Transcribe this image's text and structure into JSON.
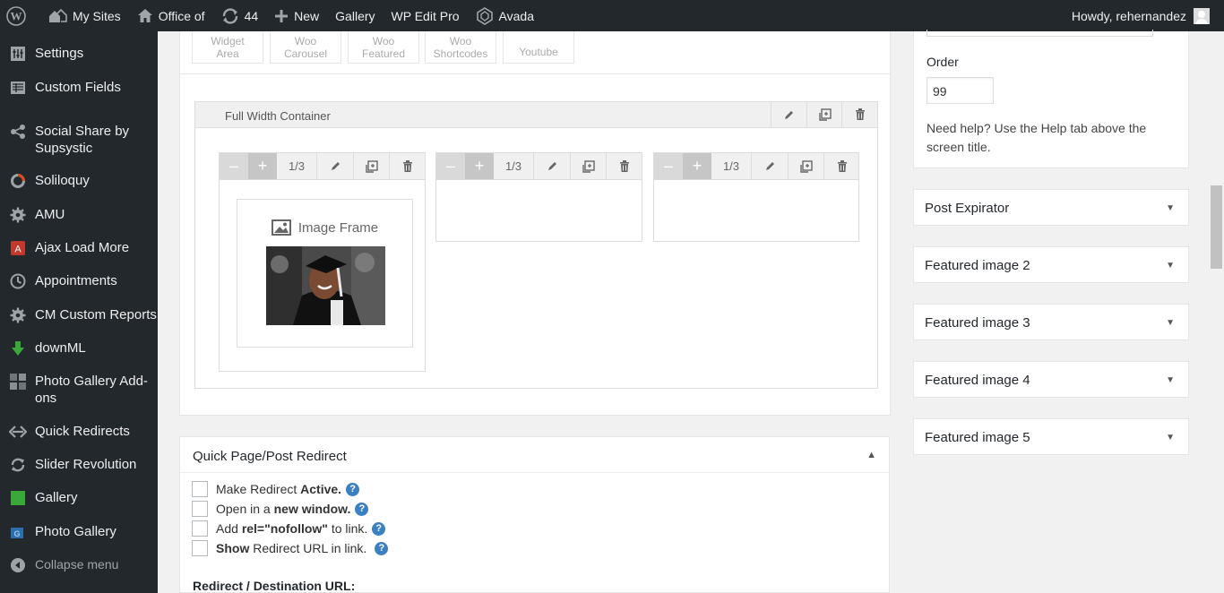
{
  "adminbar": {
    "my_sites": "My Sites",
    "site_name": "Office of",
    "updates_count": "44",
    "new_label": "New",
    "gallery_label": "Gallery",
    "wp_edit_pro_label": "WP Edit Pro",
    "avada_label": "Avada",
    "howdy": "Howdy, rehernandez"
  },
  "sidebar": {
    "items": [
      {
        "label": "Settings",
        "icon": "settings-icon"
      },
      {
        "label": "Custom Fields",
        "icon": "custom-fields-icon"
      },
      {
        "label": "Social Share by Supsystic",
        "icon": "share-icon"
      },
      {
        "label": "Soliloquy",
        "icon": "soliloquy-icon"
      },
      {
        "label": "AMU",
        "icon": "gear-icon"
      },
      {
        "label": "Ajax Load More",
        "icon": "ajax-load-more-icon"
      },
      {
        "label": "Appointments",
        "icon": "clock-icon"
      },
      {
        "label": "CM Custom Reports",
        "icon": "gear-icon"
      },
      {
        "label": "downML",
        "icon": "download-arrow-icon"
      },
      {
        "label": "Photo Gallery Add-ons",
        "icon": "photo-gallery-addons-icon"
      },
      {
        "label": "Quick Redirects",
        "icon": "redirect-icon"
      },
      {
        "label": "Slider Revolution",
        "icon": "refresh-icon"
      },
      {
        "label": "Gallery",
        "icon": "gallery-icon"
      },
      {
        "label": "Photo Gallery",
        "icon": "photo-gallery-icon"
      }
    ],
    "collapse_label": "Collapse menu"
  },
  "builder": {
    "elements": [
      {
        "label": "Widget Area"
      },
      {
        "label": "Woo Carousel"
      },
      {
        "label": "Woo Featured"
      },
      {
        "label": "Woo Shortcodes"
      },
      {
        "label": "Youtube"
      }
    ],
    "container_title": "Full Width Container",
    "columns": [
      {
        "size": "1/3"
      },
      {
        "size": "1/3"
      },
      {
        "size": "1/3"
      }
    ],
    "image_frame_label": "Image Frame"
  },
  "redirect": {
    "title": "Quick Page/Post Redirect",
    "options": [
      {
        "pre": "Make Redirect ",
        "bold": "Active.",
        "post": ""
      },
      {
        "pre": "Open in a ",
        "bold": "new window.",
        "post": ""
      },
      {
        "pre": "Add ",
        "bold": "rel=\"nofollow\"",
        "post": " to link."
      },
      {
        "pre": "",
        "bold": "Show",
        "post": " Redirect URL in link."
      }
    ],
    "help_glyph": "?",
    "destination_label": "Redirect / Destination URL:"
  },
  "order": {
    "label": "Order",
    "value": "99",
    "help_text": "Need help? Use the Help tab above the screen title."
  },
  "postboxes": [
    {
      "title": "Post Expirator"
    },
    {
      "title": "Featured image 2"
    },
    {
      "title": "Featured image 3"
    },
    {
      "title": "Featured image 4"
    },
    {
      "title": "Featured image 5"
    }
  ],
  "colors": {
    "adminbar_bg": "#23282d",
    "sidebar_bg": "#23282d",
    "help_blue": "#3b80c2",
    "page_bg": "#f1f1f1"
  }
}
